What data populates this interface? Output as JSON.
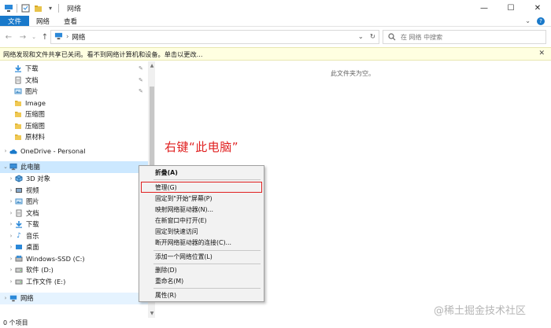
{
  "titlebar": {
    "title": "网络"
  },
  "window": {
    "minimize": "—",
    "maximize": "☐",
    "close": "✕"
  },
  "ribbon": {
    "tabs": [
      "文件",
      "网络",
      "查看"
    ],
    "expand": "⌄",
    "help": "?"
  },
  "nav": {
    "back": "←",
    "forward": "→",
    "recent": "⌄",
    "up": "↑"
  },
  "address": {
    "sep": "›",
    "location": "网络",
    "dropdown": "⌄",
    "refresh": "↻"
  },
  "search": {
    "placeholder": "在 网络 中搜索"
  },
  "infobar": {
    "text": "网络发现和文件共享已关闭。看不到网络计算机和设备。单击以更改...",
    "close": "✕"
  },
  "sidebar": {
    "items": [
      {
        "label": "下载",
        "icon": "download-arrow-icon",
        "pinned": true
      },
      {
        "label": "文档",
        "icon": "document-icon",
        "pinned": true
      },
      {
        "label": "图片",
        "icon": "picture-icon",
        "pinned": true
      },
      {
        "label": "Image",
        "icon": "folder-icon"
      },
      {
        "label": "压缩图",
        "icon": "folder-icon"
      },
      {
        "label": "压缩图",
        "icon": "folder-icon"
      },
      {
        "label": "原材料",
        "icon": "folder-icon"
      },
      {
        "label": "OneDrive - Personal",
        "icon": "cloud-icon"
      },
      {
        "label": "此电脑",
        "icon": "computer-icon"
      },
      {
        "label": "3D 对象",
        "icon": "3d-objects-icon"
      },
      {
        "label": "视频",
        "icon": "video-icon"
      },
      {
        "label": "图片",
        "icon": "picture-icon"
      },
      {
        "label": "文档",
        "icon": "document-icon"
      },
      {
        "label": "下载",
        "icon": "download-arrow-icon"
      },
      {
        "label": "音乐",
        "icon": "music-icon"
      },
      {
        "label": "桌面",
        "icon": "desktop-icon"
      },
      {
        "label": "Windows-SSD (C:)",
        "icon": "drive-icon"
      },
      {
        "label": "软件 (D:)",
        "icon": "drive-icon"
      },
      {
        "label": "工作文件 (E:)",
        "icon": "drive-icon"
      },
      {
        "label": "网络",
        "icon": "network-icon"
      }
    ]
  },
  "content": {
    "empty_message": "此文件夹为空。"
  },
  "annotation": "右键“此电脑”",
  "context_menu": {
    "items": [
      "折叠(A)",
      "管理(G)",
      "固定到\"开始\"屏幕(P)",
      "映射网络驱动器(N)...",
      "在新窗口中打开(E)",
      "固定到快速访问",
      "断开网络驱动器的连接(C)...",
      "添加一个网络位置(L)",
      "删除(D)",
      "重命名(M)",
      "属性(R)"
    ],
    "highlighted": "管理(G)"
  },
  "status": {
    "text": "0 个项目"
  },
  "watermark": "@稀土掘金技术社区",
  "colors": {
    "accent": "#1979ca",
    "selection": "#cce8ff",
    "infobar": "#ffffe1",
    "annotation": "#e02020"
  }
}
